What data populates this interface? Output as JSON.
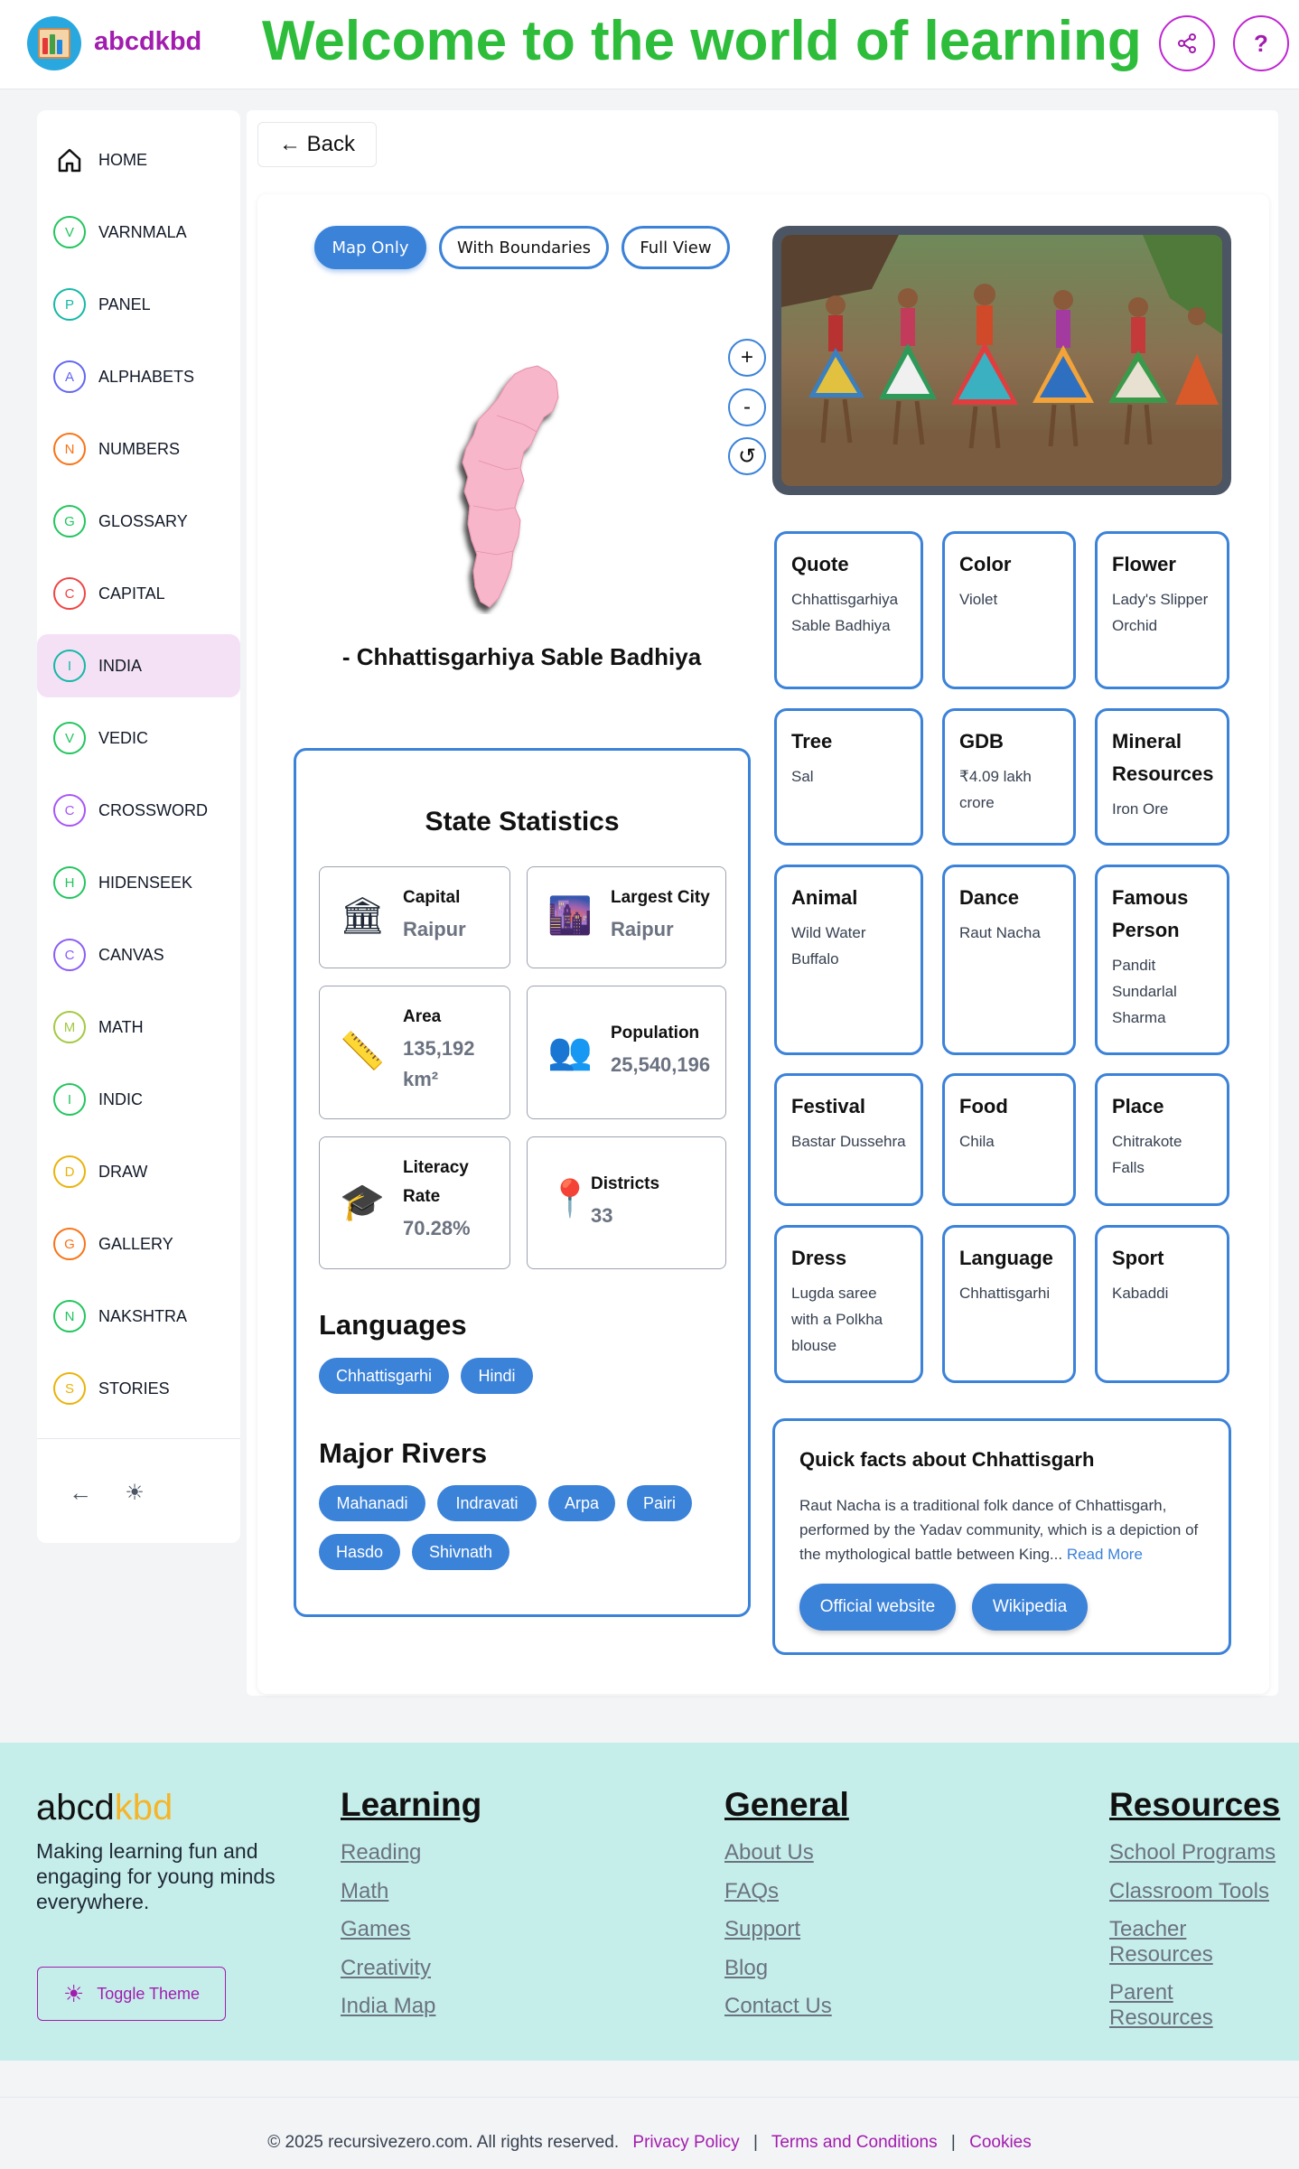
{
  "header": {
    "brand": "abcdkbd",
    "title": "Welcome to the world of learning",
    "help_label": "?"
  },
  "sidebar": {
    "items": [
      {
        "label": "HOME",
        "letter": "",
        "color": "#111111"
      },
      {
        "label": "VARNMALA",
        "letter": "V",
        "color": "#22c55e"
      },
      {
        "label": "PANEL",
        "letter": "P",
        "color": "#14b8a6"
      },
      {
        "label": "ALPHABETS",
        "letter": "A",
        "color": "#6366f1"
      },
      {
        "label": "NUMBERS",
        "letter": "N",
        "color": "#f97316"
      },
      {
        "label": "GLOSSARY",
        "letter": "G",
        "color": "#22c55e"
      },
      {
        "label": "CAPITAL",
        "letter": "C",
        "color": "#ef4444"
      },
      {
        "label": "INDIA",
        "letter": "I",
        "color": "#14b8a6"
      },
      {
        "label": "VEDIC",
        "letter": "V",
        "color": "#22c55e"
      },
      {
        "label": "CROSSWORD",
        "letter": "C",
        "color": "#a855f7"
      },
      {
        "label": "HIDENSEEK",
        "letter": "H",
        "color": "#22c55e"
      },
      {
        "label": "CANVAS",
        "letter": "C",
        "color": "#8b5cf6"
      },
      {
        "label": "MATH",
        "letter": "M",
        "color": "#a3c940"
      },
      {
        "label": "INDIC",
        "letter": "I",
        "color": "#22c55e"
      },
      {
        "label": "DRAW",
        "letter": "D",
        "color": "#eab308"
      },
      {
        "label": "GALLERY",
        "letter": "G",
        "color": "#f97316"
      },
      {
        "label": "NAKSHTRA",
        "letter": "N",
        "color": "#22c55e"
      },
      {
        "label": "STORIES",
        "letter": "S",
        "color": "#eab308"
      }
    ],
    "active_index": 7
  },
  "main": {
    "back_label": "← Back",
    "map_tabs": [
      "Map Only",
      "With Boundaries",
      "Full View"
    ],
    "zoom": {
      "in": "+",
      "out": "-",
      "reset": "↺"
    },
    "map_caption": "- Chhattisgarhiya Sable Badhiya",
    "facts": [
      {
        "title": "Quote",
        "value": "Chhattisgarhiya Sable Badhiya"
      },
      {
        "title": "Color",
        "value": "Violet"
      },
      {
        "title": "Flower",
        "value": "Lady's Slipper Orchid"
      },
      {
        "title": "Tree",
        "value": "Sal"
      },
      {
        "title": "GDB",
        "value": "₹4.09 lakh crore"
      },
      {
        "title": "Mineral Resources",
        "value": "Iron Ore"
      },
      {
        "title": "Animal",
        "value": "Wild Water Buffalo"
      },
      {
        "title": "Dance",
        "value": "Raut Nacha"
      },
      {
        "title": "Famous Person",
        "value": "Pandit Sundarlal Sharma"
      },
      {
        "title": "Festival",
        "value": "Bastar Dussehra"
      },
      {
        "title": "Food",
        "value": "Chila"
      },
      {
        "title": "Place",
        "value": "Chitrakote Falls"
      },
      {
        "title": "Dress",
        "value": "Lugda saree with a Polkha blouse"
      },
      {
        "title": "Language",
        "value": "Chhattisgarhi"
      },
      {
        "title": "Sport",
        "value": "Kabaddi"
      }
    ],
    "stats": {
      "title": "State Statistics",
      "capital": {
        "label": "Capital",
        "value": "Raipur"
      },
      "largest_city": {
        "label": "Largest City",
        "value": "Raipur"
      },
      "area": {
        "label": "Area",
        "value": "135,192 km²"
      },
      "population": {
        "label": "Population",
        "value": "25,540,196"
      },
      "literacy": {
        "label": "Literacy Rate",
        "value": "70.28%"
      },
      "districts": {
        "label": "Districts",
        "value": "33"
      }
    },
    "languages_heading": "Languages",
    "languages": [
      "Chhattisgarhi",
      "Hindi"
    ],
    "rivers_heading": "Major Rivers",
    "rivers": [
      "Mahanadi",
      "Indravati",
      "Arpa",
      "Pairi",
      "Hasdo",
      "Shivnath"
    ],
    "quick_facts": {
      "title": "Quick facts about Chhattisgarh",
      "text": "Raut Nacha is a traditional folk dance of Chhattisgarh, performed by the Yadav community, which is a depiction of the mythological battle between King...",
      "read_more": "Read More",
      "official_label": "Official website",
      "wiki_label": "Wikipedia"
    }
  },
  "footer": {
    "brand_a": "abcd",
    "brand_b": "kbd",
    "tagline": "Making learning fun and engaging for young minds everywhere.",
    "toggle_label": "Toggle Theme",
    "columns": [
      {
        "heading": "Learning",
        "links": [
          "Reading",
          "Math",
          "Games",
          "Creativity",
          "India Map"
        ]
      },
      {
        "heading": "General",
        "links": [
          "About Us",
          "FAQs",
          "Support",
          "Blog",
          "Contact Us"
        ]
      },
      {
        "heading": "Resources",
        "links": [
          "School Programs",
          "Classroom Tools",
          "Teacher Resources",
          "Parent Resources"
        ]
      }
    ],
    "copyright": "© 2025 recursivezero.com. All rights reserved.",
    "privacy": "Privacy Policy",
    "terms": "Terms and Conditions",
    "cookies": "Cookies"
  },
  "colors": {
    "accent_blue": "#3b82d9",
    "brand_magenta": "#a21caf",
    "hero_green": "#2dbd3b",
    "footer_bg": "#c5eeea",
    "map_fill": "#f7b6c9"
  }
}
